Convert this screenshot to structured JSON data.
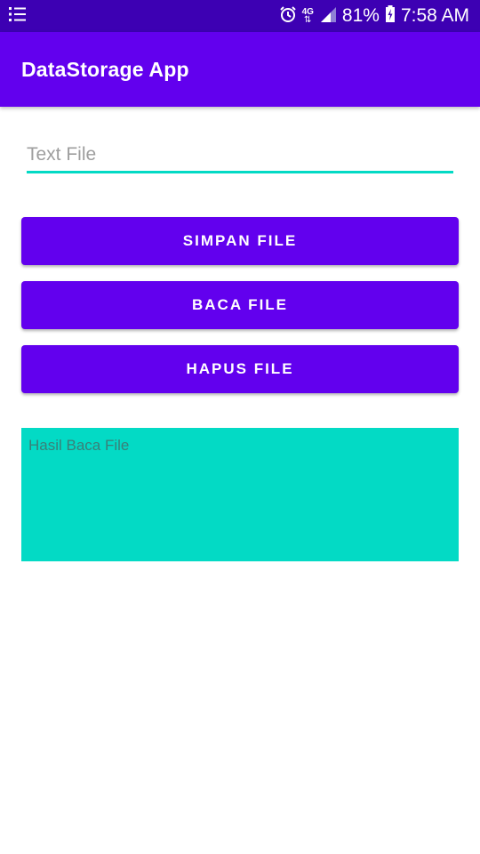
{
  "status_bar": {
    "menu_icon": "list-icon",
    "alarm_icon": "alarm-clock-icon",
    "network_label": "4G",
    "signal_icon": "signal-icon",
    "battery_percent": "81%",
    "battery_icon": "battery-charging-icon",
    "time": "7:58 AM"
  },
  "app_bar": {
    "title": "DataStorage App"
  },
  "form": {
    "text_field_value": "",
    "text_field_placeholder": "Text File",
    "save_button": "SIMPAN FILE",
    "read_button": "BACA FILE",
    "delete_button": "HAPUS FILE",
    "result_text": "Hasil Baca File"
  },
  "colors": {
    "status_bar": "#3d00b3",
    "primary": "#6200ee",
    "accent": "#03dac5",
    "result_text": "#3a7f78"
  }
}
